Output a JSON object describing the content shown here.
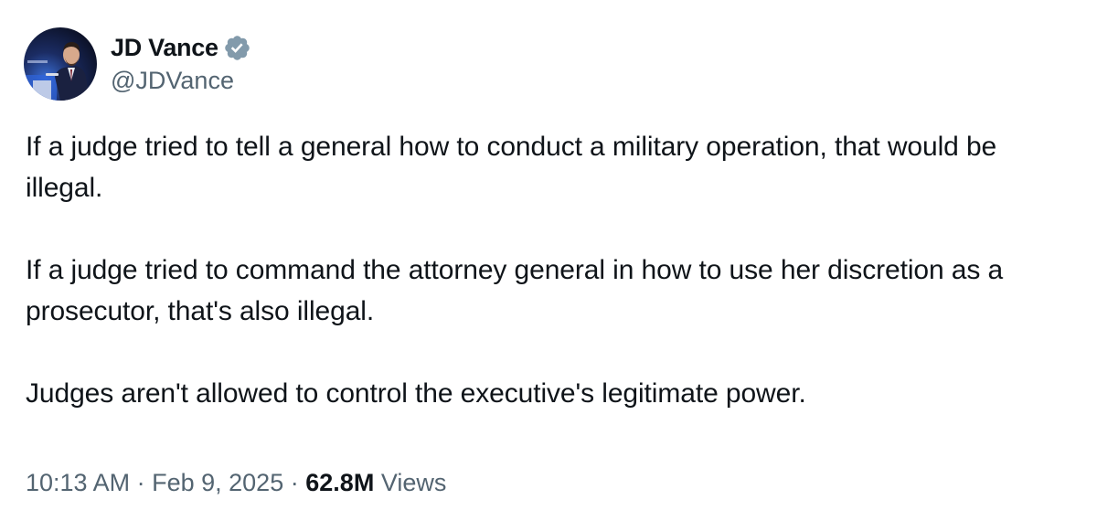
{
  "author": {
    "display_name": "JD Vance",
    "handle": "@JDVance",
    "verified_icon": "verified-badge-icon",
    "verified_color": "#829aab"
  },
  "tweet": {
    "paragraphs": [
      "If a judge tried to tell a general how to conduct a military operation, that would be illegal.",
      "If a judge tried to command the attorney general in how to use her discretion as a prosecutor, that's also illegal.",
      "Judges aren't allowed to control the executive's legitimate power."
    ]
  },
  "meta": {
    "time": "10:13 AM",
    "separator": "·",
    "date": "Feb 9, 2025",
    "views_count": "62.8M",
    "views_label": "Views"
  },
  "colors": {
    "text_primary": "#0f1419",
    "text_secondary": "#536471",
    "background": "#ffffff"
  }
}
